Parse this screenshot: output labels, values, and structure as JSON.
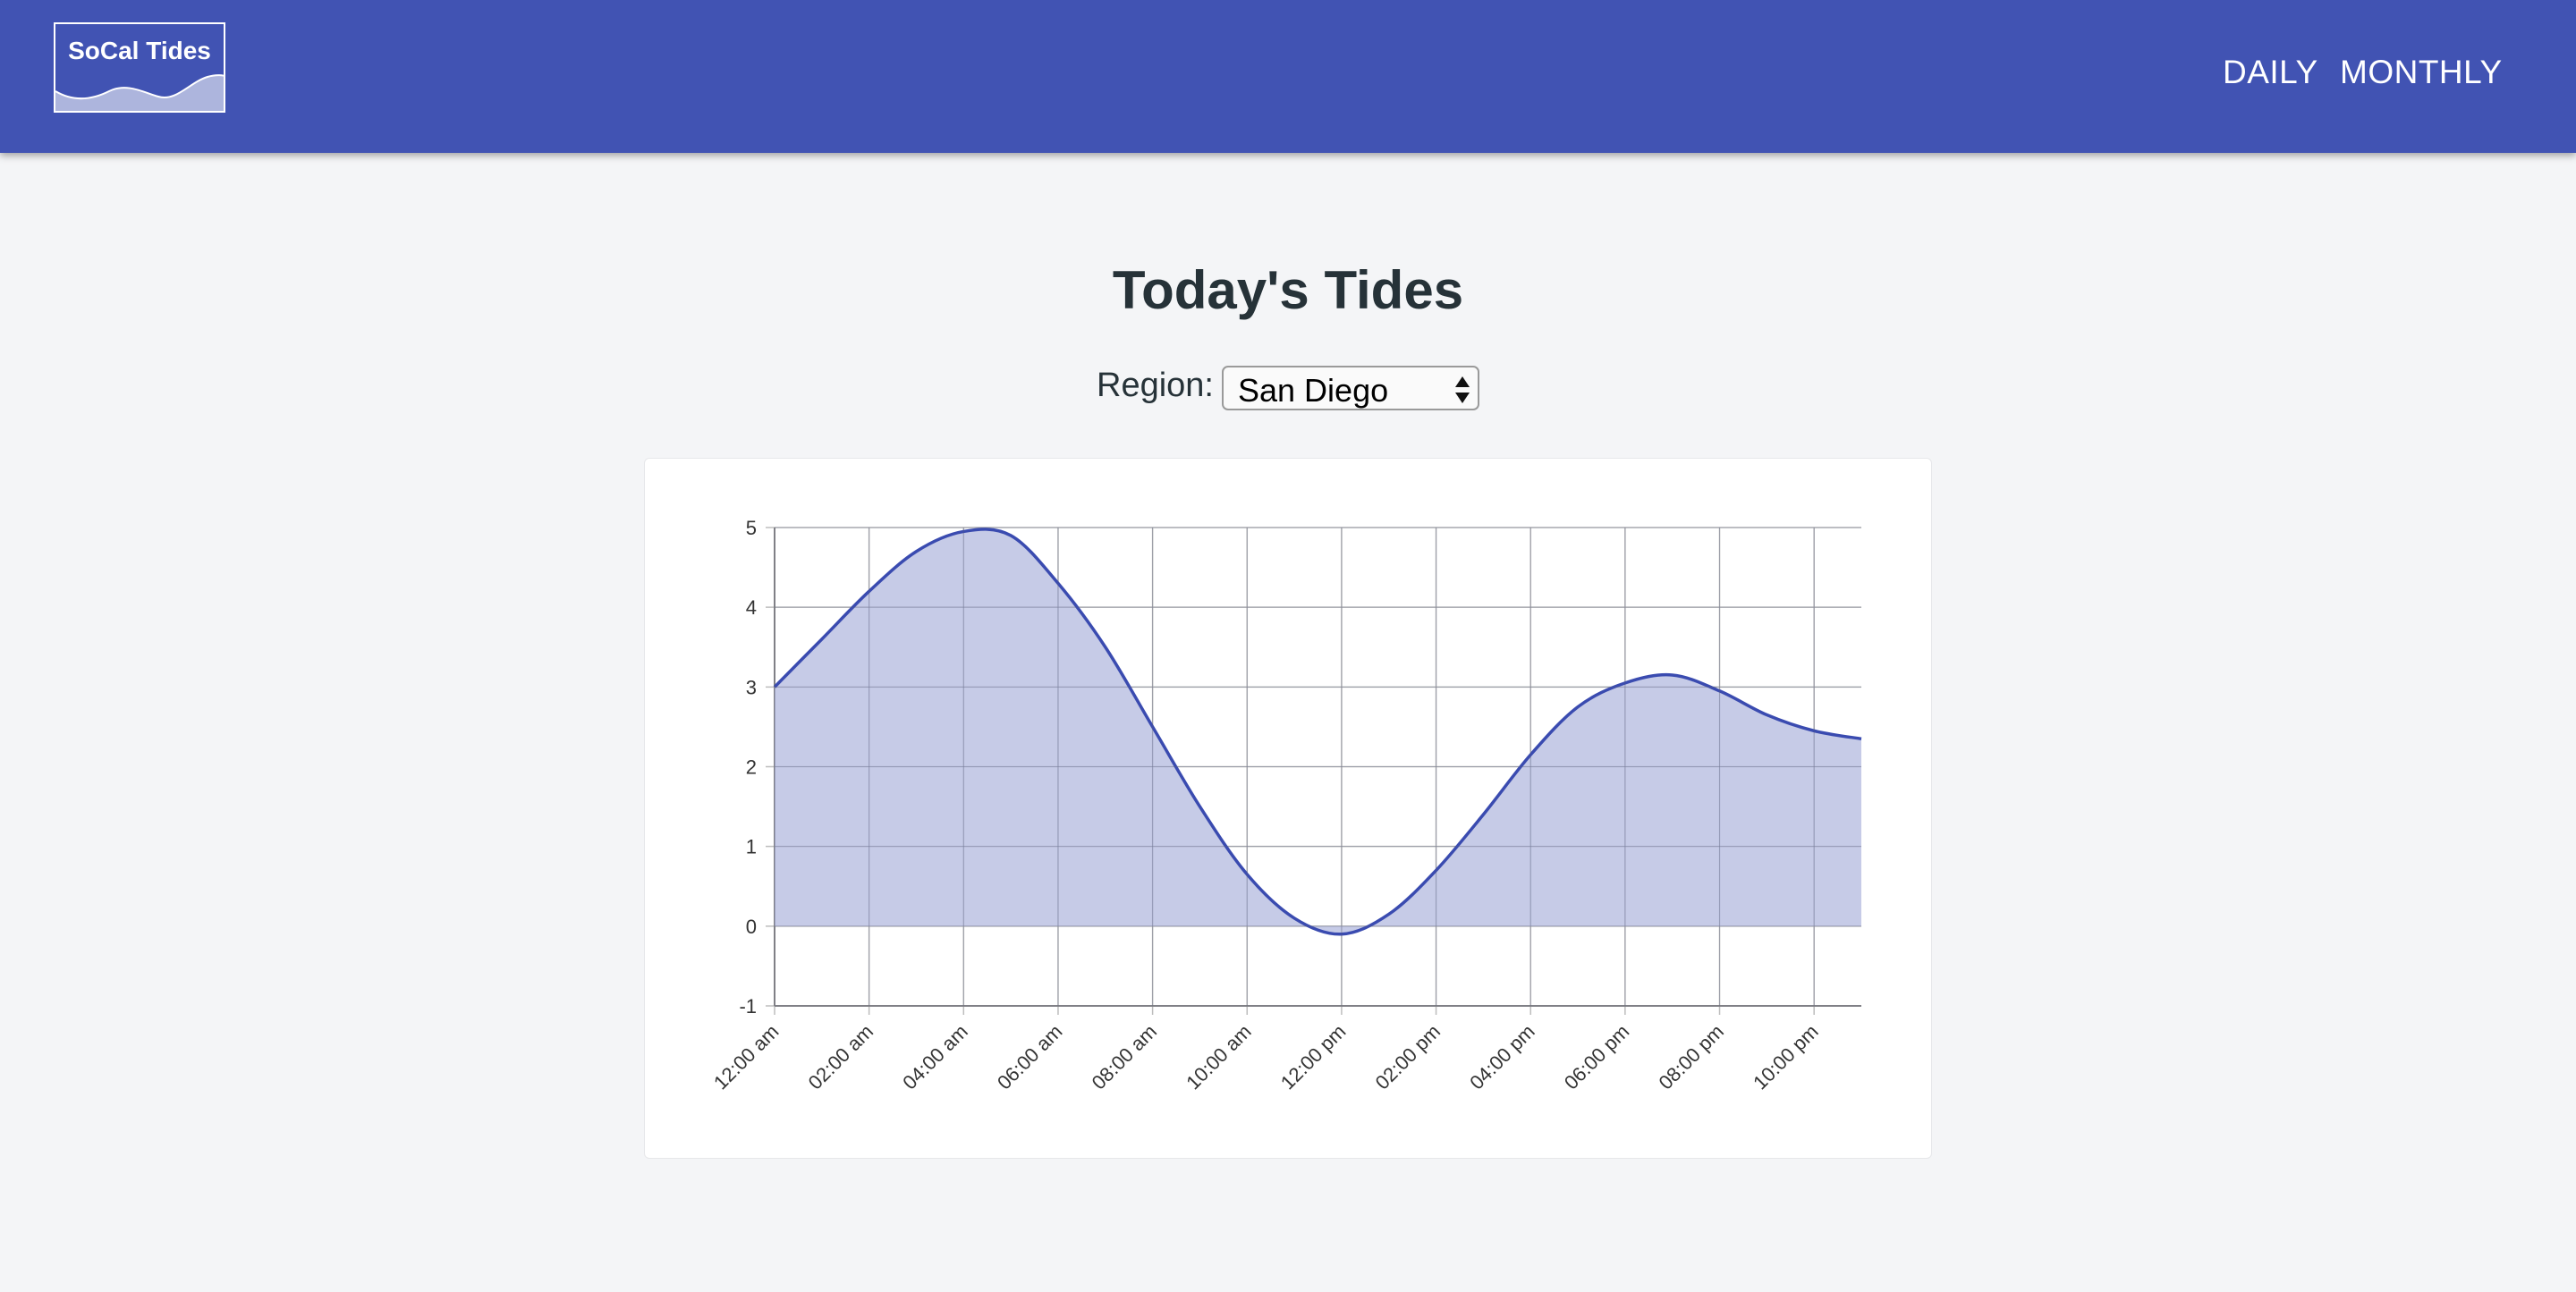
{
  "header": {
    "logo_text": "SoCal Tides",
    "nav": [
      {
        "label": "DAILY"
      },
      {
        "label": "MONTHLY"
      }
    ]
  },
  "main": {
    "title": "Today's Tides",
    "region_label": "Region:",
    "region_value": "San Diego"
  },
  "colors": {
    "header_bg": "#4153b3",
    "line": "#3a4bb0",
    "fill": "#b3badf"
  },
  "chart_data": {
    "type": "area",
    "title": "",
    "xlabel": "",
    "ylabel": "",
    "x_ticks": [
      "12:00 am",
      "02:00 am",
      "04:00 am",
      "06:00 am",
      "08:00 am",
      "10:00 am",
      "12:00 pm",
      "02:00 pm",
      "04:00 pm",
      "06:00 pm",
      "08:00 pm",
      "10:00 pm"
    ],
    "x_hours": [
      0,
      1,
      2,
      3,
      4,
      5,
      6,
      7,
      8,
      9,
      10,
      11,
      12,
      13,
      14,
      15,
      16,
      17,
      18,
      19,
      20,
      21,
      22,
      23
    ],
    "series": [
      {
        "values": [
          3.0,
          3.6,
          4.2,
          4.7,
          4.95,
          4.9,
          4.3,
          3.5,
          2.5,
          1.5,
          0.65,
          0.1,
          -0.1,
          0.15,
          0.7,
          1.4,
          2.15,
          2.75,
          3.05,
          3.15,
          2.95,
          2.65,
          2.45,
          2.35
        ]
      }
    ],
    "ylim": [
      -1,
      5
    ],
    "y_ticks": [
      5,
      4,
      3,
      2,
      1,
      0,
      -1
    ],
    "grid": true,
    "legend": "none"
  }
}
